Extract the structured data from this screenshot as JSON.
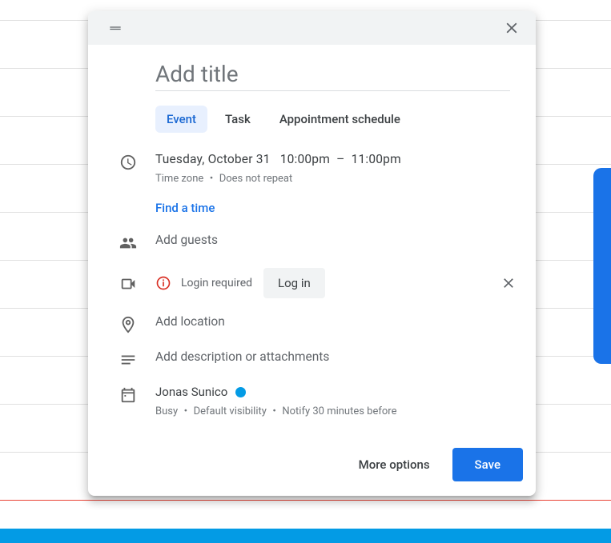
{
  "title_placeholder": "Add title",
  "tabs": {
    "event": "Event",
    "task": "Task",
    "appointment": "Appointment schedule"
  },
  "datetime": {
    "date": "Tuesday, October 31",
    "start": "10:00pm",
    "sep": "–",
    "end": "11:00pm",
    "sub": "Time zone ・ Does not repeat"
  },
  "find_time": "Find a time",
  "guests_placeholder": "Add guests",
  "video": {
    "warn": "Login required",
    "login_btn": "Log in"
  },
  "location_placeholder": "Add location",
  "description_placeholder": "Add description or attachments",
  "calendar": {
    "owner": "Jonas Sunico",
    "color": "#039be5",
    "sub": "Busy ・ Default visibility ・ Notify 30 minutes before"
  },
  "footer": {
    "more": "More options",
    "save": "Save"
  }
}
